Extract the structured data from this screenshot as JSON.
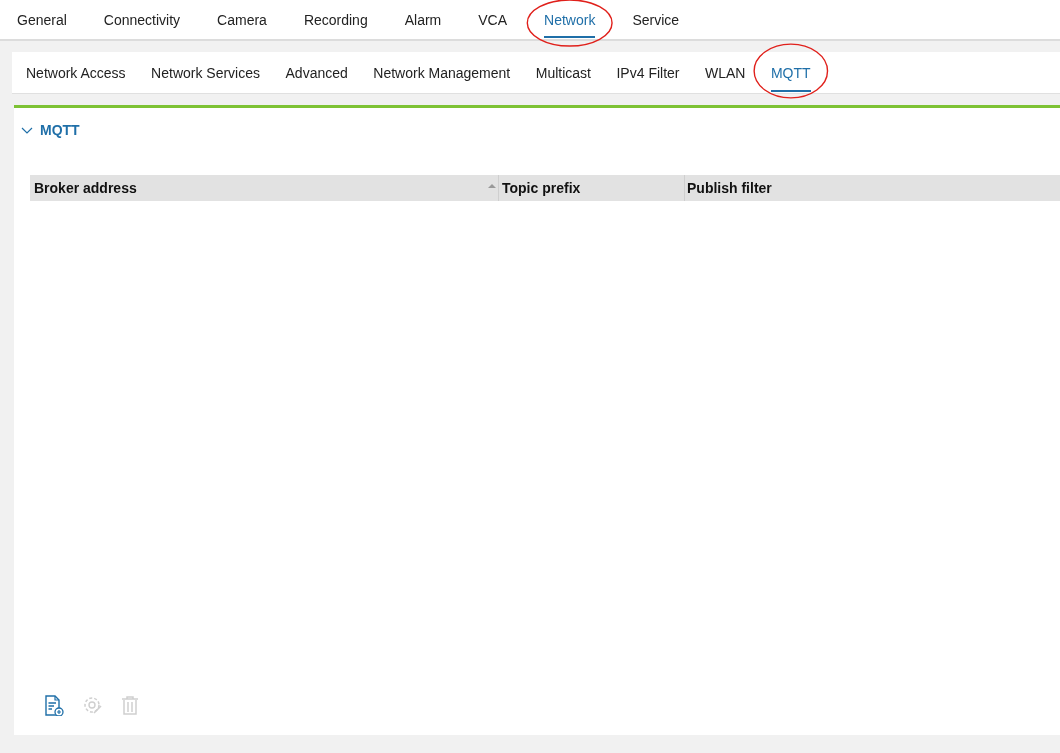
{
  "main_tabs": [
    {
      "label": "General",
      "selected": false,
      "highlighted": false
    },
    {
      "label": "Connectivity",
      "selected": false,
      "highlighted": false
    },
    {
      "label": "Camera",
      "selected": false,
      "highlighted": false
    },
    {
      "label": "Recording",
      "selected": false,
      "highlighted": false
    },
    {
      "label": "Alarm",
      "selected": false,
      "highlighted": false
    },
    {
      "label": "VCA",
      "selected": false,
      "highlighted": false
    },
    {
      "label": "Network",
      "selected": true,
      "highlighted": true
    },
    {
      "label": "Service",
      "selected": false,
      "highlighted": false
    }
  ],
  "sub_tabs": [
    {
      "label": "Network Access",
      "selected": false,
      "highlighted": false
    },
    {
      "label": "Network Services",
      "selected": false,
      "highlighted": false
    },
    {
      "label": "Advanced",
      "selected": false,
      "highlighted": false
    },
    {
      "label": "Network Management",
      "selected": false,
      "highlighted": false
    },
    {
      "label": "Multicast",
      "selected": false,
      "highlighted": false
    },
    {
      "label": "IPv4 Filter",
      "selected": false,
      "highlighted": false
    },
    {
      "label": "WLAN",
      "selected": false,
      "highlighted": false
    },
    {
      "label": "MQTT",
      "selected": true,
      "highlighted": true
    }
  ],
  "section": {
    "title": "MQTT",
    "expanded": true
  },
  "table": {
    "columns": [
      {
        "label": "Broker address",
        "sorted": true
      },
      {
        "label": "Topic prefix",
        "sorted": false
      },
      {
        "label": "Publish filter",
        "sorted": false
      }
    ]
  },
  "toolbar": [
    {
      "kind": "add",
      "disabled": false
    },
    {
      "kind": "settings",
      "disabled": true
    },
    {
      "kind": "delete",
      "disabled": true
    }
  ]
}
